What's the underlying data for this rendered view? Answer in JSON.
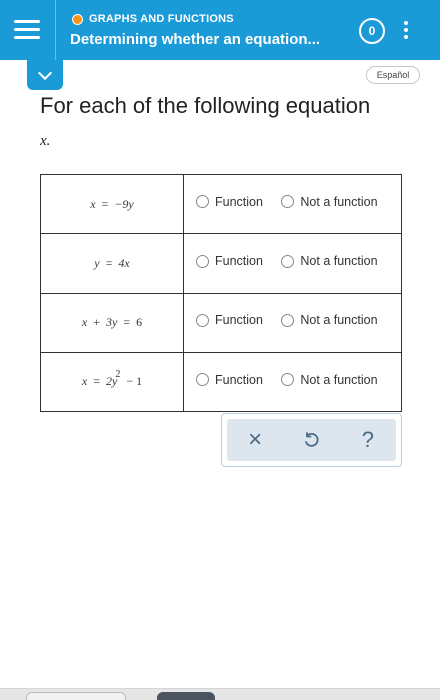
{
  "header": {
    "topic": "GRAPHS AND FUNCTIONS",
    "title": "Determining whether an equation...",
    "progress": "0",
    "colors": {
      "bar": "#1a9bd7",
      "topic_dot": "#f7941d"
    }
  },
  "language_button": "Español",
  "instruction": "For each of the following equation",
  "variable": "x.",
  "table": {
    "rows": [
      {
        "eq": {
          "lhs": "x",
          "op": "=",
          "rhs": "−9y"
        },
        "option_a": "Function",
        "option_b": "Not a function"
      },
      {
        "eq": {
          "lhs": "y",
          "op": "=",
          "rhs": "4x"
        },
        "option_a": "Function",
        "option_b": "Not a function"
      },
      {
        "eq": {
          "lhs": "x",
          "op": "+",
          "rhs": "3y",
          "op2": "=",
          "rhs2": "6"
        },
        "option_a": "Function",
        "option_b": "Not a function"
      },
      {
        "eq": {
          "lhs": "x",
          "op": "=",
          "rhs": "2y",
          "sup": "2",
          "tail": "− 1"
        },
        "option_a": "Function",
        "option_b": "Not a function"
      }
    ]
  },
  "actions": {
    "clear_icon": "×",
    "undo_icon": "undo-icon",
    "help_icon": "?"
  }
}
